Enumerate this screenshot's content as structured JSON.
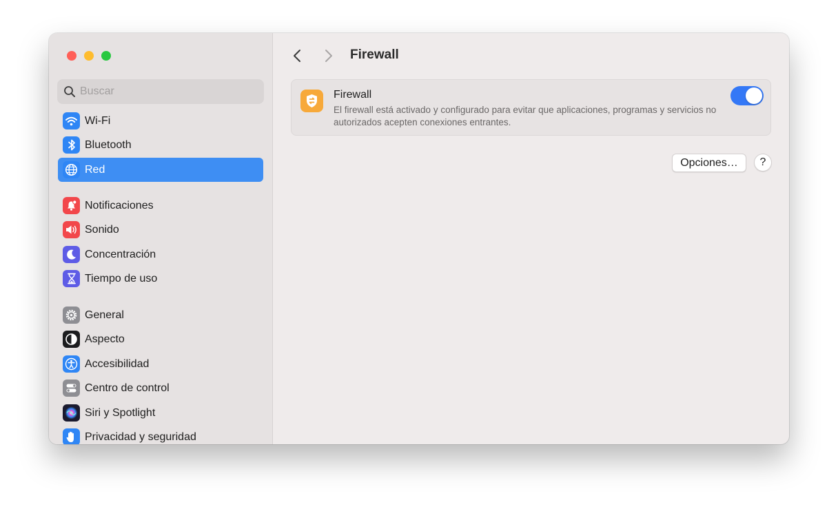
{
  "sidebar": {
    "search": {
      "placeholder": "Buscar",
      "icon": "search-icon"
    },
    "items": [
      {
        "label": "Wi-Fi",
        "icon": "wifi-icon",
        "color": "#2f86f5"
      },
      {
        "label": "Bluetooth",
        "icon": "bluetooth-icon",
        "color": "#2f86f5"
      },
      {
        "label": "Red",
        "icon": "globe-icon",
        "color": "#2f86f5",
        "selected": true
      },
      {
        "label": "Notificaciones",
        "icon": "bell-icon",
        "color": "#f2474b"
      },
      {
        "label": "Sonido",
        "icon": "speaker-icon",
        "color": "#f2474b"
      },
      {
        "label": "Concentración",
        "icon": "moon-icon",
        "color": "#5e5ce6"
      },
      {
        "label": "Tiempo de uso",
        "icon": "hourglass-icon",
        "color": "#5e5ce6"
      },
      {
        "label": "General",
        "icon": "gear-icon",
        "color": "#8e8e93"
      },
      {
        "label": "Aspecto",
        "icon": "appearance-icon",
        "color": "#1c1c1e"
      },
      {
        "label": "Accesibilidad",
        "icon": "accessibility-icon",
        "color": "#2f86f5"
      },
      {
        "label": "Centro de control",
        "icon": "control-center-icon",
        "color": "#8e8e93"
      },
      {
        "label": "Siri y Spotlight",
        "icon": "siri-icon",
        "color": "#3b3b8f"
      },
      {
        "label": "Privacidad y seguridad",
        "icon": "hand-icon",
        "color": "#2f86f5"
      }
    ]
  },
  "header": {
    "title": "Firewall"
  },
  "firewall": {
    "title": "Firewall",
    "description": "El firewall está activado y configurado para evitar que aplicaciones, programas y servicios no autorizados acepten conexiones entrantes.",
    "enabled": true,
    "icon": "firewall-shield-icon",
    "icon_color": "#f7a93a",
    "toggle_color": "#3478f6"
  },
  "buttons": {
    "options_label": "Opciones…",
    "help_label": "?"
  },
  "colors": {
    "accent": "#3e8ef3",
    "close": "#ff5f57",
    "minimize": "#febc2e",
    "maximize": "#28c840"
  }
}
